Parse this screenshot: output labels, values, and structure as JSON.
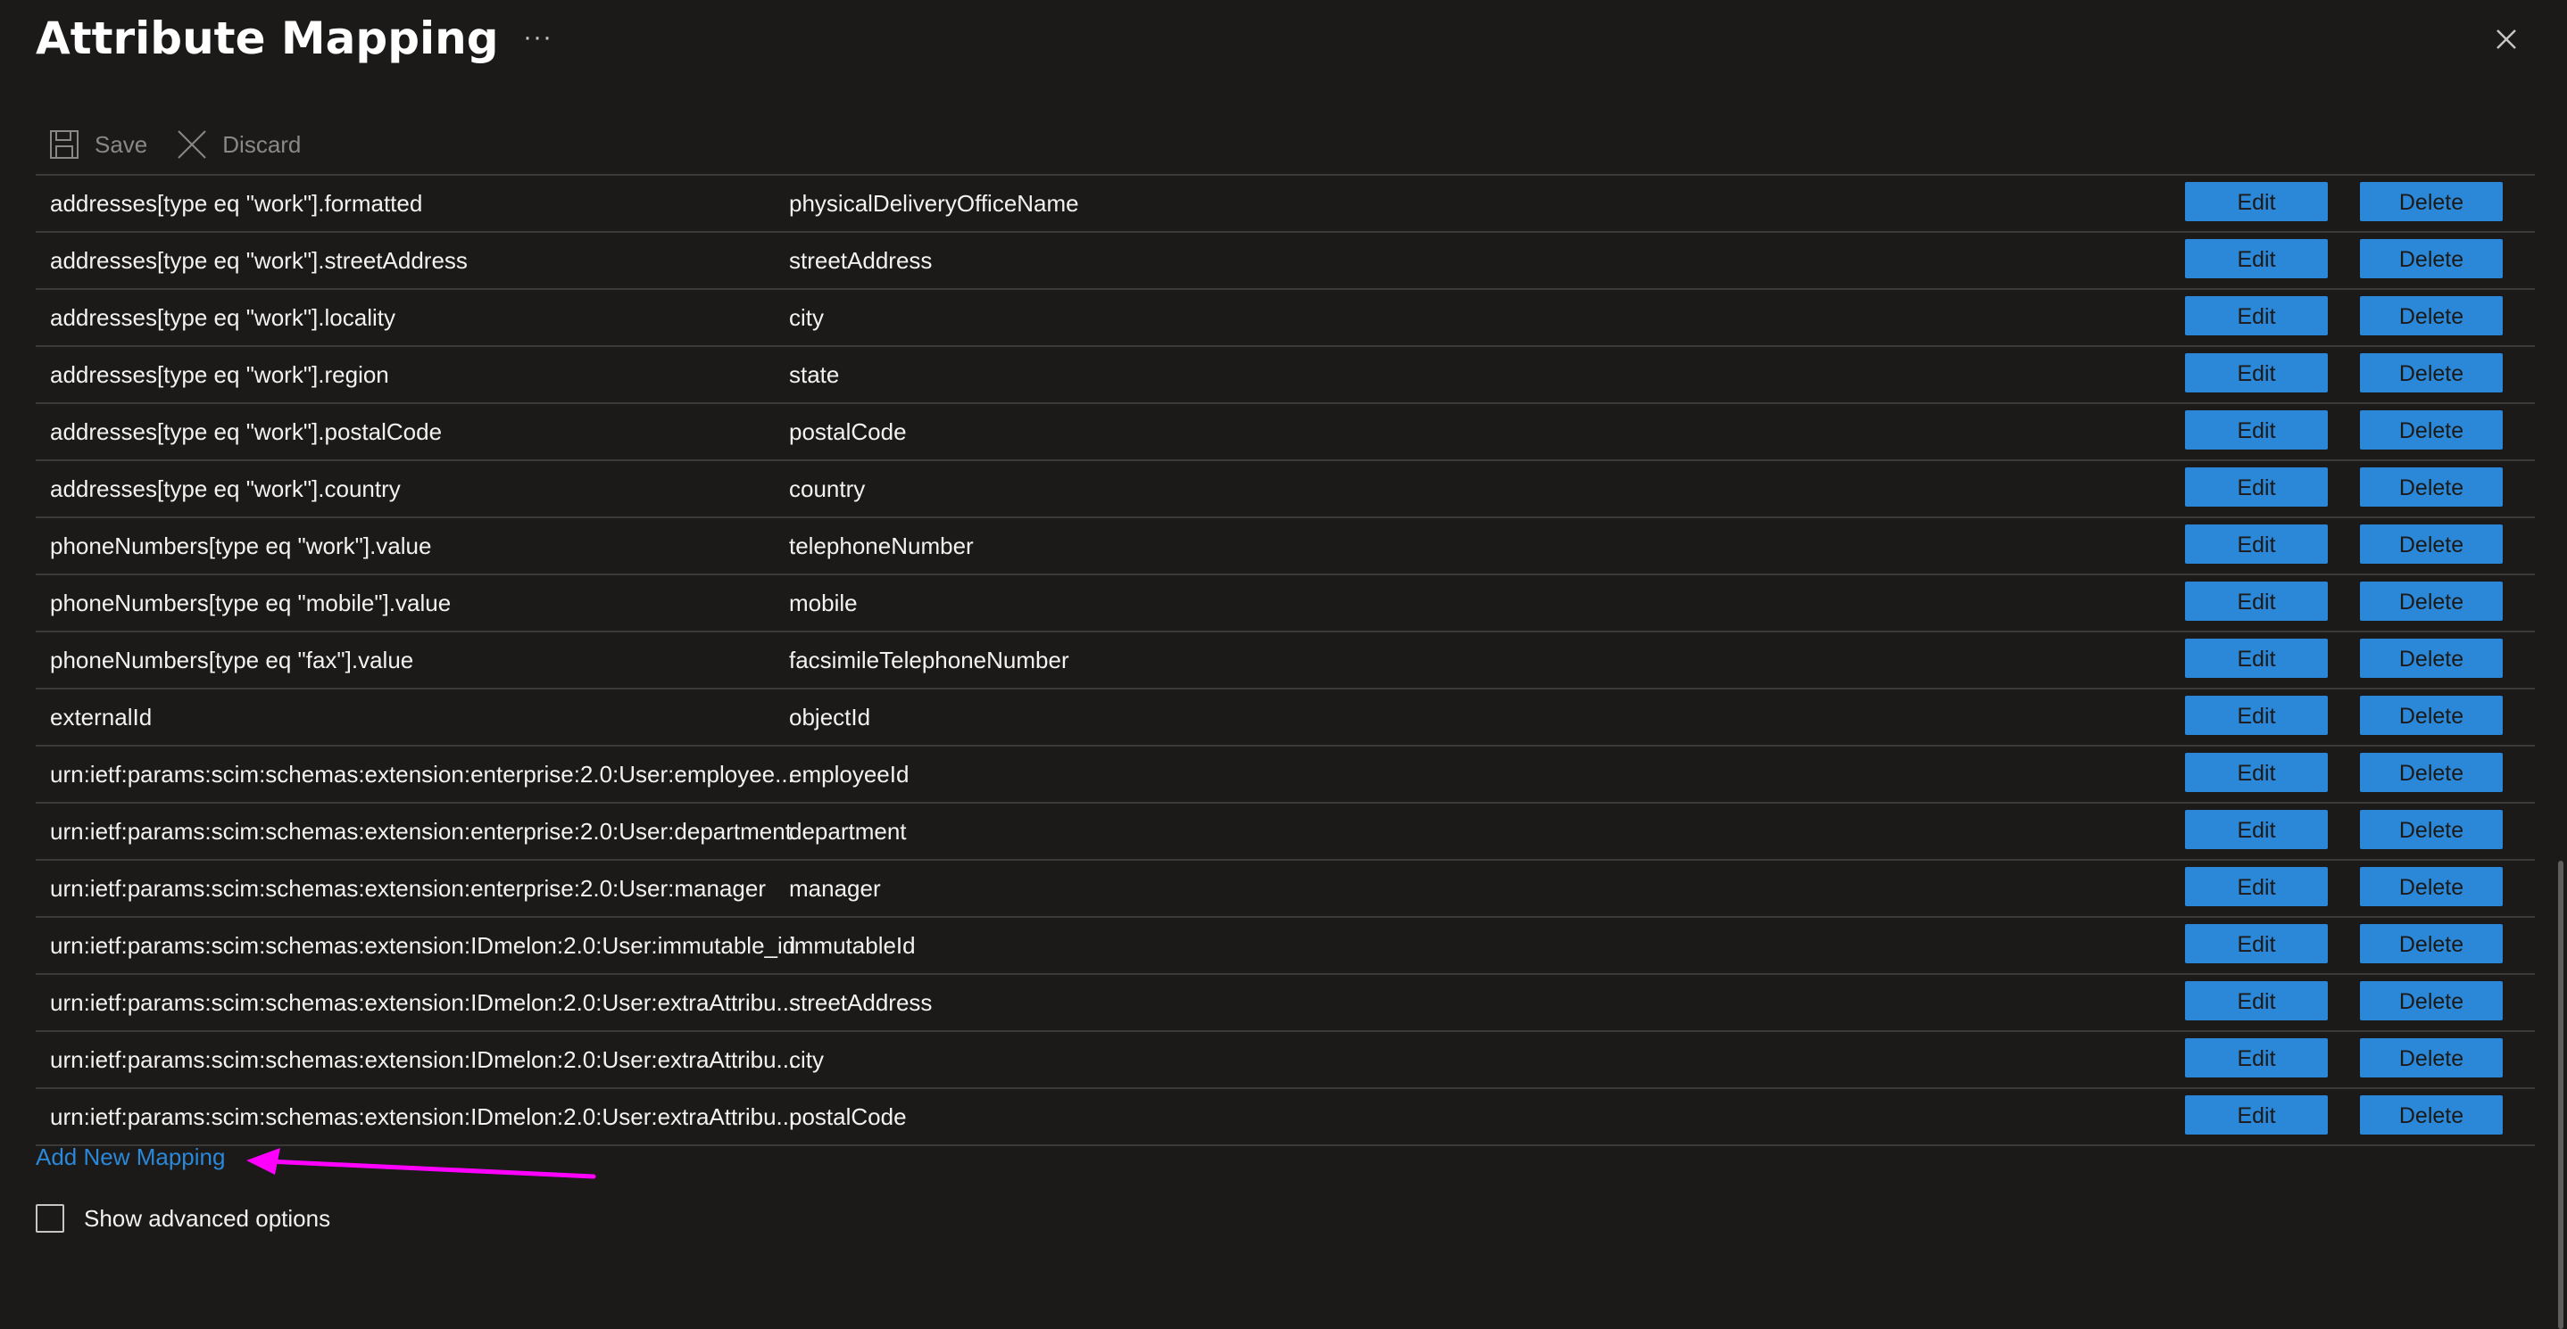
{
  "header": {
    "title": "Attribute Mapping",
    "more_label": "···"
  },
  "toolbar": {
    "save_label": "Save",
    "discard_label": "Discard"
  },
  "mappings": [
    {
      "source": "addresses[type eq \"work\"].formatted",
      "target": "physicalDeliveryOfficeName",
      "edit": "Edit",
      "delete": "Delete"
    },
    {
      "source": "addresses[type eq \"work\"].streetAddress",
      "target": "streetAddress",
      "edit": "Edit",
      "delete": "Delete"
    },
    {
      "source": "addresses[type eq \"work\"].locality",
      "target": "city",
      "edit": "Edit",
      "delete": "Delete"
    },
    {
      "source": "addresses[type eq \"work\"].region",
      "target": "state",
      "edit": "Edit",
      "delete": "Delete"
    },
    {
      "source": "addresses[type eq \"work\"].postalCode",
      "target": "postalCode",
      "edit": "Edit",
      "delete": "Delete"
    },
    {
      "source": "addresses[type eq \"work\"].country",
      "target": "country",
      "edit": "Edit",
      "delete": "Delete"
    },
    {
      "source": "phoneNumbers[type eq \"work\"].value",
      "target": "telephoneNumber",
      "edit": "Edit",
      "delete": "Delete"
    },
    {
      "source": "phoneNumbers[type eq \"mobile\"].value",
      "target": "mobile",
      "edit": "Edit",
      "delete": "Delete"
    },
    {
      "source": "phoneNumbers[type eq \"fax\"].value",
      "target": "facsimileTelephoneNumber",
      "edit": "Edit",
      "delete": "Delete"
    },
    {
      "source": "externalId",
      "target": "objectId",
      "edit": "Edit",
      "delete": "Delete"
    },
    {
      "source": "urn:ietf:params:scim:schemas:extension:enterprise:2.0:User:employee...",
      "target": "employeeId",
      "edit": "Edit",
      "delete": "Delete"
    },
    {
      "source": "urn:ietf:params:scim:schemas:extension:enterprise:2.0:User:department",
      "target": "department",
      "edit": "Edit",
      "delete": "Delete"
    },
    {
      "source": "urn:ietf:params:scim:schemas:extension:enterprise:2.0:User:manager",
      "target": "manager",
      "edit": "Edit",
      "delete": "Delete"
    },
    {
      "source": "urn:ietf:params:scim:schemas:extension:IDmelon:2.0:User:immutable_id",
      "target": "immutableId",
      "edit": "Edit",
      "delete": "Delete"
    },
    {
      "source": "urn:ietf:params:scim:schemas:extension:IDmelon:2.0:User:extraAttribu...",
      "target": "streetAddress",
      "edit": "Edit",
      "delete": "Delete"
    },
    {
      "source": "urn:ietf:params:scim:schemas:extension:IDmelon:2.0:User:extraAttribu...",
      "target": "city",
      "edit": "Edit",
      "delete": "Delete"
    },
    {
      "source": "urn:ietf:params:scim:schemas:extension:IDmelon:2.0:User:extraAttribu...",
      "target": "postalCode",
      "edit": "Edit",
      "delete": "Delete"
    }
  ],
  "footer": {
    "add_mapping_label": "Add New Mapping",
    "advanced_label": "Show advanced options",
    "advanced_checked": false
  },
  "colors": {
    "background": "#1b1a19",
    "button": "#2b88d8",
    "link": "#2b88d8",
    "annotation_arrow": "#ff00ff"
  },
  "icons": {
    "close": "close-icon",
    "save": "save-icon",
    "discard": "discard-icon",
    "arrow": "arrow-annotation"
  }
}
